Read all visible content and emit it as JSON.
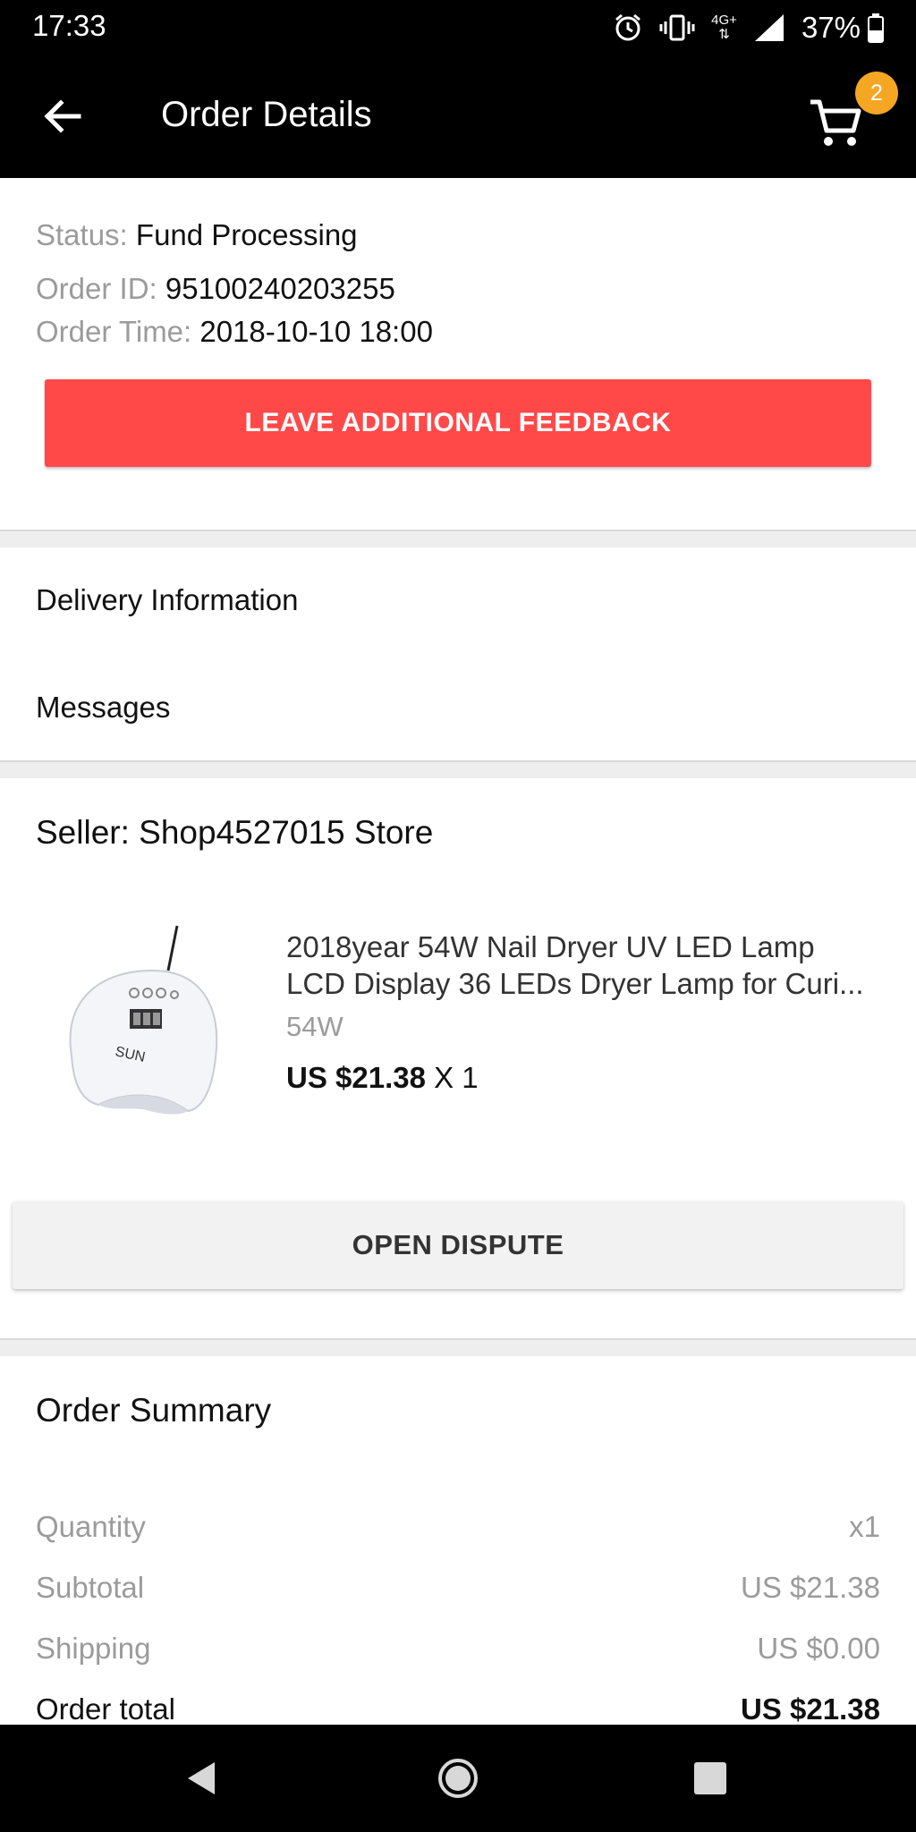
{
  "status_bar": {
    "time": "17:33",
    "network": "4G+",
    "battery": "37%",
    "icons": [
      "alarm-icon",
      "vibrate-icon",
      "network-icon",
      "signal-icon",
      "battery-icon"
    ]
  },
  "app_bar": {
    "title": "Order Details",
    "cart_count": "2",
    "back_icon": "arrow-left-icon",
    "cart_icon": "cart-icon"
  },
  "order": {
    "status_label": "Status:",
    "status_value": "Fund Processing",
    "id_label": "Order ID:",
    "id_value": "95100240203255",
    "time_label": "Order Time:",
    "time_value": "2018-10-10 18:00",
    "feedback_button": "LEAVE ADDITIONAL FEEDBACK"
  },
  "menu": {
    "delivery": "Delivery Information",
    "messages": "Messages"
  },
  "seller": {
    "label": "Seller: Shop4527015 Store"
  },
  "product": {
    "title_line1": "2018year 54W Nail Dryer UV LED Lamp",
    "title_line2": "LCD Display 36 LEDs Dryer Lamp for Curi...",
    "variant": "54W",
    "price": "US $21.38",
    "quantity": "X 1",
    "image_label": "SUN"
  },
  "dispute_button": "OPEN DISPUTE",
  "summary": {
    "title": "Order Summary",
    "quantity_label": "Quantity",
    "quantity_value": "x1",
    "subtotal_label": "Subtotal",
    "subtotal_value": "US $21.38",
    "shipping_label": "Shipping",
    "shipping_value": "US $0.00",
    "total_label": "Order total",
    "total_value": "US $21.38"
  },
  "colors": {
    "accent_red": "#ff4949",
    "badge_orange": "#f5a623",
    "bar_black": "#000000"
  }
}
